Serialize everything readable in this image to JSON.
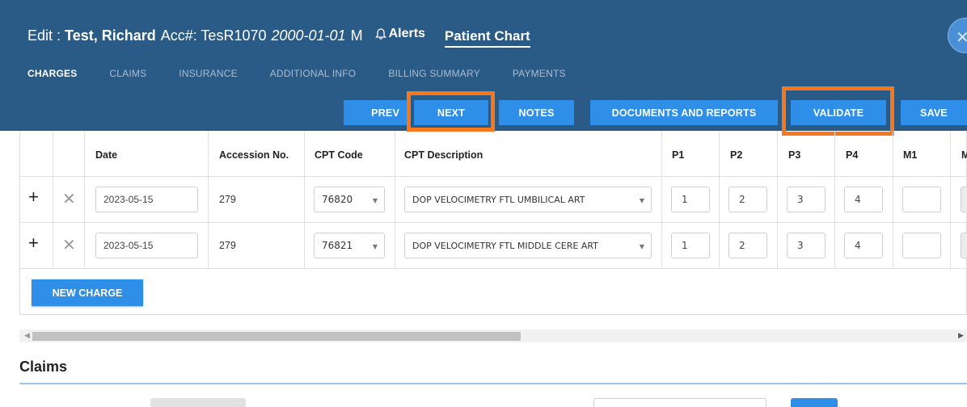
{
  "header": {
    "edit_label": "Edit :",
    "patient_name": "Test, Richard",
    "acc_label": "Acc#: TesR1070",
    "dob": "2000-01-01",
    "sex": "M",
    "alerts_label": "Alerts",
    "patient_chart_label": "Patient Chart",
    "close_glyph": "✕"
  },
  "tabs": [
    {
      "label": "CHARGES",
      "active": true
    },
    {
      "label": "CLAIMS"
    },
    {
      "label": "INSURANCE"
    },
    {
      "label": "ADDITIONAL INFO"
    },
    {
      "label": "BILLING SUMMARY"
    },
    {
      "label": "PAYMENTS"
    }
  ],
  "toolbar": {
    "prev": "PREV",
    "next": "NEXT",
    "notes": "NOTES",
    "documents": "DOCUMENTS AND REPORTS",
    "validate": "VALIDATE",
    "save": "SAVE"
  },
  "table": {
    "headers": {
      "date": "Date",
      "accession": "Accession No.",
      "cpt_code": "CPT Code",
      "cpt_desc": "CPT Description",
      "p1": "P1",
      "p2": "P2",
      "p3": "P3",
      "p4": "P4",
      "m1": "M1",
      "m2": "M"
    },
    "rows": [
      {
        "add": "+",
        "remove": "✕",
        "date": "2023-05-15",
        "accession": "279",
        "cpt_code": "76820",
        "cpt_desc": "DOP VELOCIMETRY FTL UMBILICAL ART",
        "p1": "1",
        "p2": "2",
        "p3": "3",
        "p4": "4",
        "m1": ""
      },
      {
        "add": "+",
        "remove": "✕",
        "date": "2023-05-15",
        "accession": "279",
        "cpt_code": "76821",
        "cpt_desc": "DOP VELOCIMETRY FTL MIDDLE CERE ART",
        "p1": "1",
        "p2": "2",
        "p3": "3",
        "p4": "4",
        "m1": ""
      }
    ]
  },
  "new_charge_label": "NEW CHARGE",
  "claims_title": "Claims",
  "colors": {
    "header_bg": "#2a5a86",
    "button_blue": "#2f8ee8",
    "highlight_orange": "#f5781f"
  }
}
